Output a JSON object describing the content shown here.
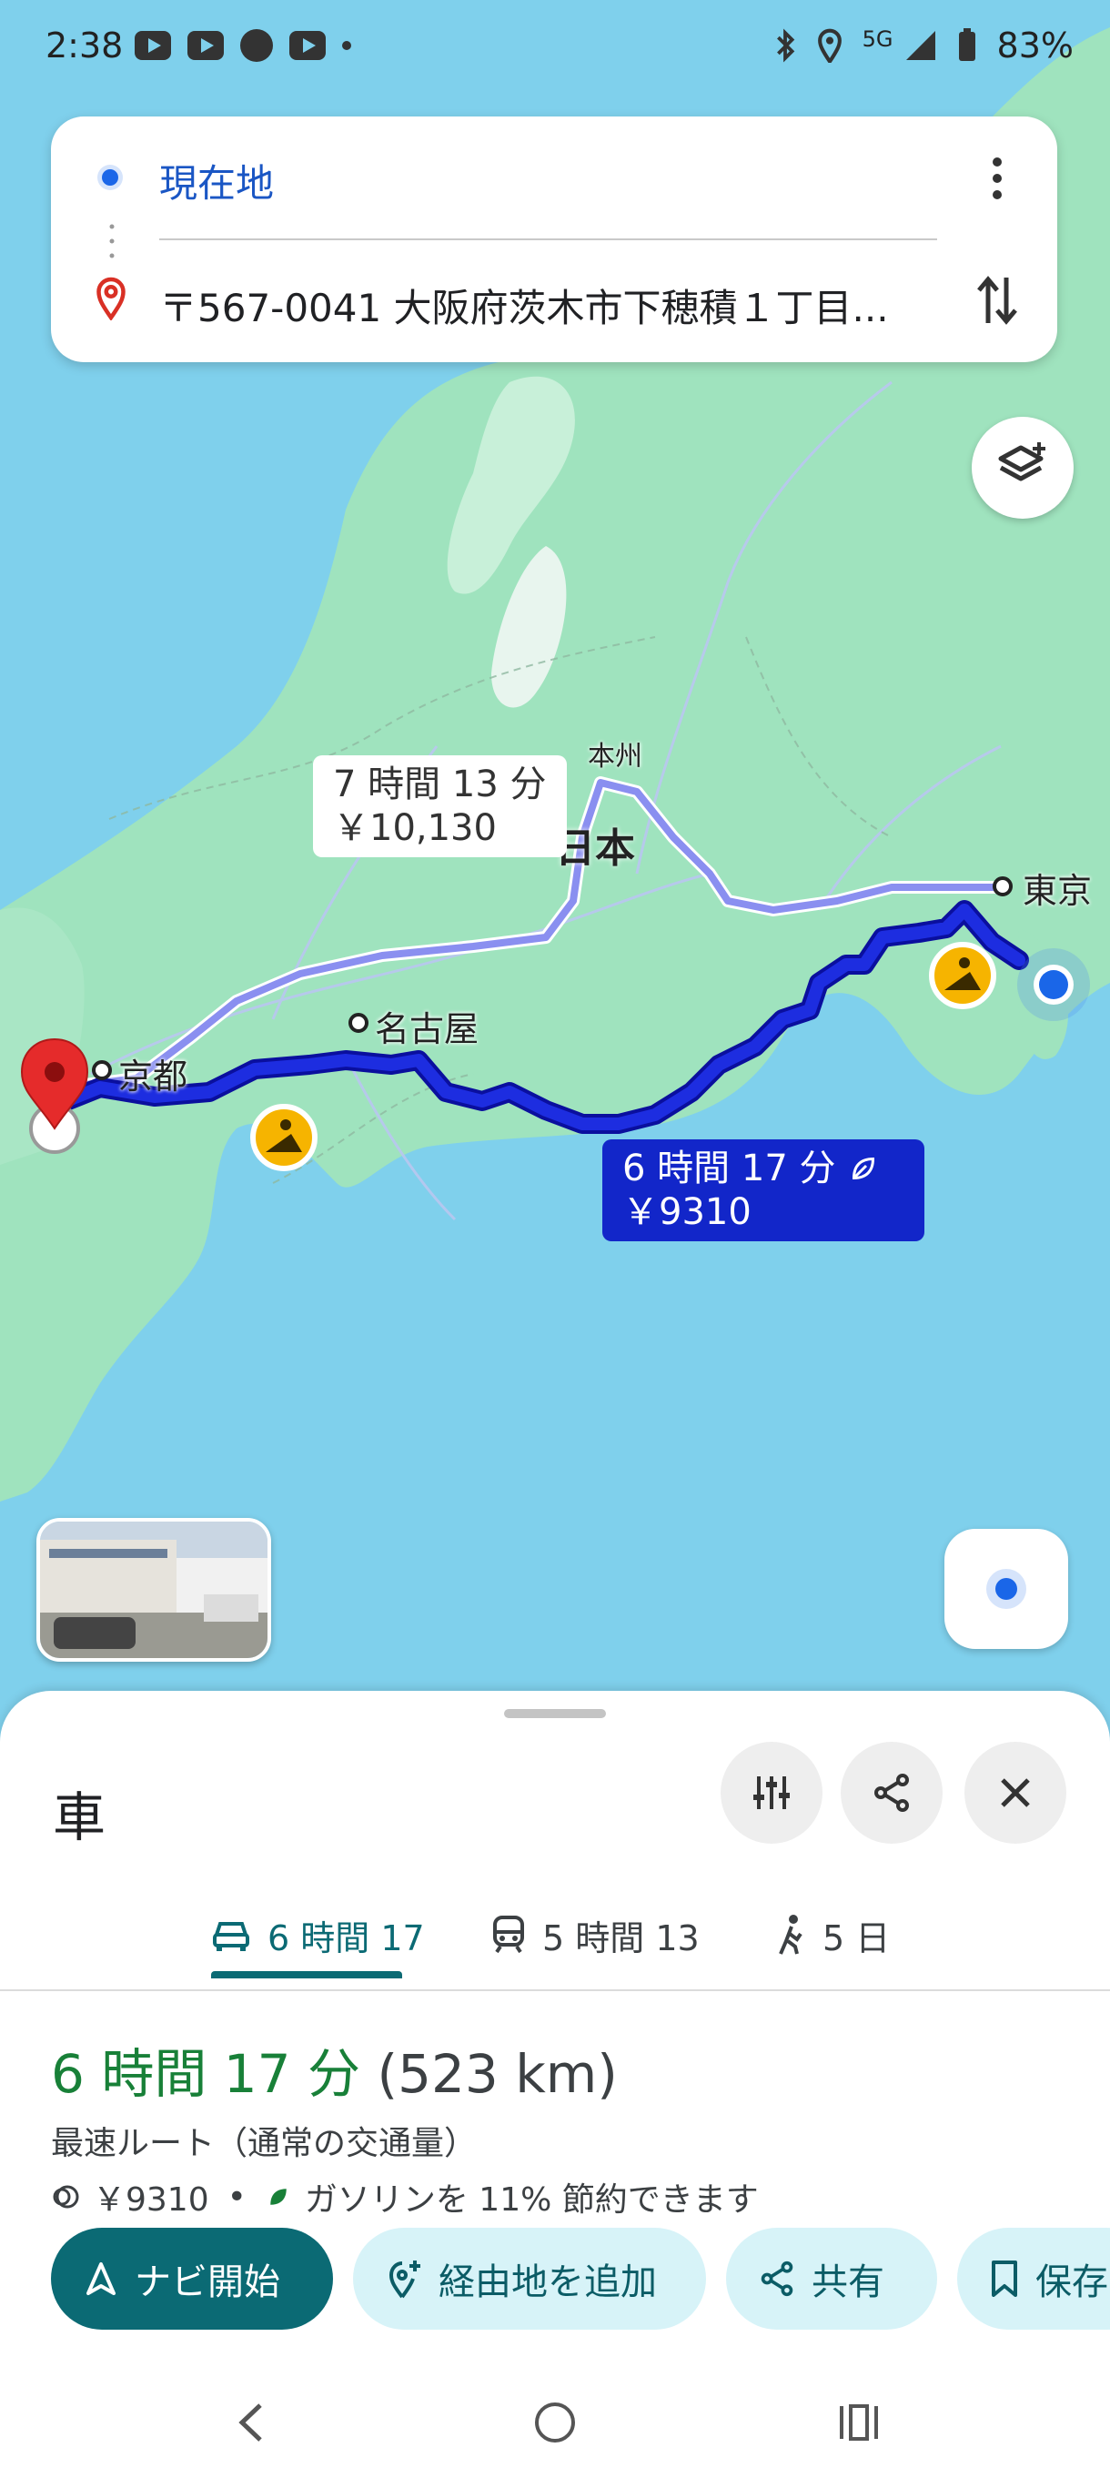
{
  "status_bar": {
    "time": "2:38",
    "network": "5G",
    "battery": "83%"
  },
  "search": {
    "origin": "現在地",
    "destination": "〒567-0041 大阪府茨木市下穂積１丁目..."
  },
  "map": {
    "labels": {
      "honshu": "本州",
      "japan": "日本",
      "tokyo": "東京",
      "nagoya": "名古屋",
      "kyoto": "京都"
    },
    "routes": {
      "alternative": {
        "duration": "7 時間 13 分",
        "toll": "￥10,130"
      },
      "main": {
        "duration": "6 時間 17 分",
        "toll": "￥9310"
      }
    }
  },
  "sheet": {
    "mode_title": "車",
    "tabs": [
      {
        "icon": "car-icon",
        "label": "6 時間 17",
        "active": true
      },
      {
        "icon": "train-icon",
        "label": "5 時間 13",
        "active": false
      },
      {
        "icon": "walk-icon",
        "label": "5 日",
        "active": false
      }
    ],
    "summary": {
      "duration": "6 時間 17 分",
      "distance": "(523 km)",
      "description": "最速ルート（通常の交通量）",
      "toll": "￥9310",
      "separator": "•",
      "fuel_note": "ガソリンを 11% 節約できます"
    },
    "actions": {
      "start": "ナビ開始",
      "add_stop": "経由地を追加",
      "share": "共有",
      "save": "保存"
    }
  },
  "colors": {
    "accent": "#0b6a74",
    "route_main": "#1226c9",
    "route_alt": "#8a8ff0",
    "duration_green": "#188038",
    "sea": "#7fd0ec",
    "land": "#9fe3be"
  }
}
